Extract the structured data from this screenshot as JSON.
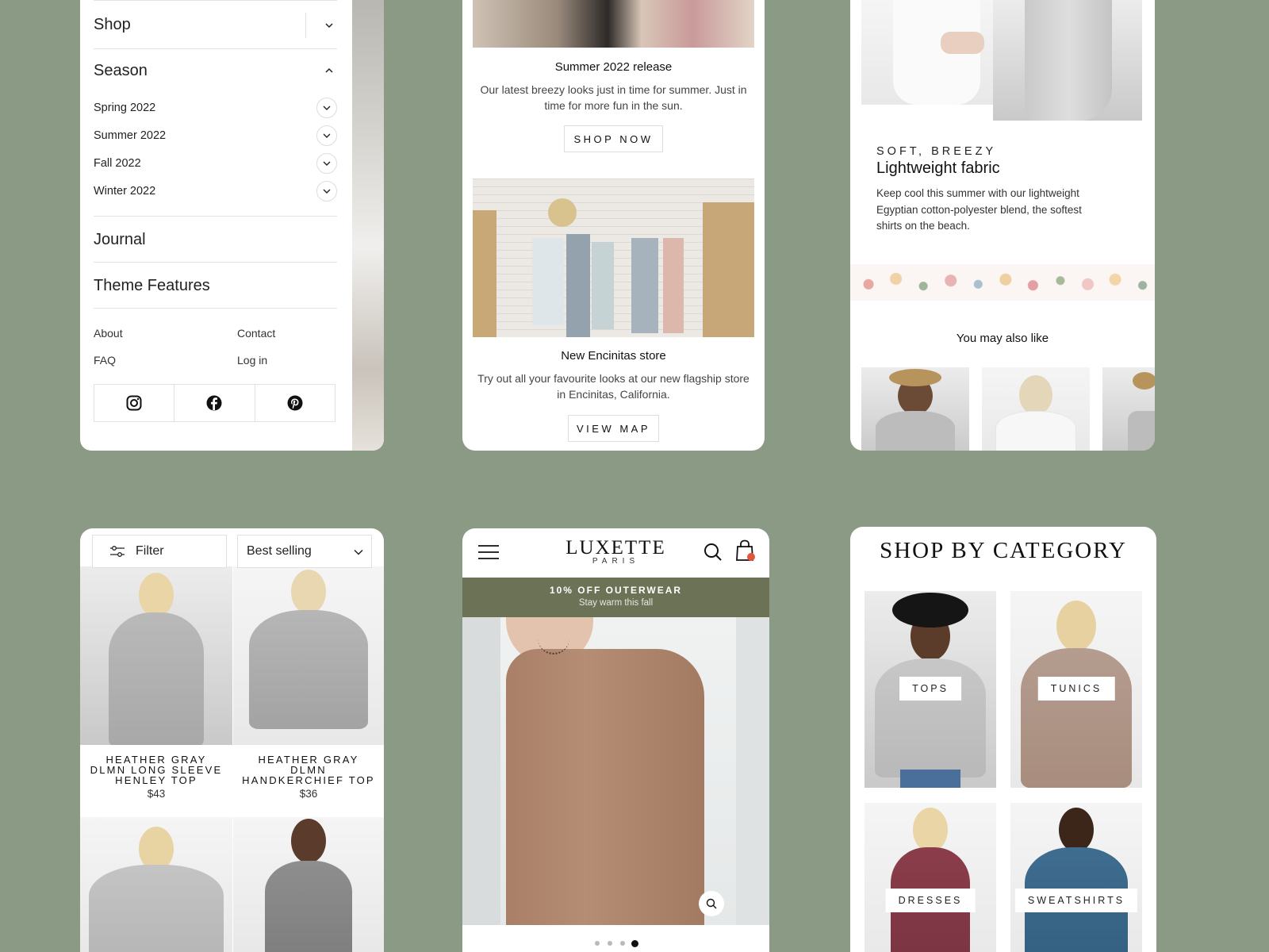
{
  "menu": {
    "shop_label": "Shop",
    "season_label": "Season",
    "season_items": [
      {
        "label": "Spring 2022"
      },
      {
        "label": "Summer 2022"
      },
      {
        "label": "Fall 2022"
      },
      {
        "label": "Winter 2022"
      }
    ],
    "journal_label": "Journal",
    "theme_features_label": "Theme Features",
    "footer_links": {
      "about": "About",
      "contact": "Contact",
      "faq": "FAQ",
      "login": "Log in"
    },
    "social_icons": [
      "instagram-icon",
      "facebook-icon",
      "pinterest-icon"
    ]
  },
  "promos": [
    {
      "title": "Summer 2022 release",
      "body": "Our latest breezy looks just in time for summer. Just in time for more fun in the sun.",
      "button": "SHOP NOW"
    },
    {
      "title": "New Encinitas store",
      "body": "Try out all your favourite looks at our new flagship store in Encinitas, California.",
      "button": "VIEW MAP"
    }
  ],
  "detail": {
    "eyebrow": "SOFT, BREEZY",
    "title": "Lightweight fabric",
    "body": "Keep cool this summer with our lightweight Egyptian cotton-polyester blend, the softest shirts on the beach.",
    "also_like": "You may also like"
  },
  "collection": {
    "filter_label": "Filter",
    "sort_value": "Best selling",
    "products": [
      {
        "name": "HEATHER GRAY DLMN LONG SLEEVE HENLEY TOP",
        "lines": [
          "HEATHER GRAY",
          "DLMN LONG SLEEVE",
          "HENLEY TOP"
        ],
        "price": "$43"
      },
      {
        "name": "HEATHER GRAY DLMN HANDKERCHIEF TOP",
        "lines": [
          "HEATHER GRAY",
          "DLMN",
          "HANDKERCHIEF TOP"
        ],
        "price": "$36"
      }
    ]
  },
  "home": {
    "brand": "LUXETTE",
    "brand_sub": "PARIS",
    "banner_title": "10% OFF OUTERWEAR",
    "banner_sub": "Stay warm this fall",
    "slide_count": 4,
    "active_slide": 4
  },
  "categories": {
    "heading": "SHOP BY CATEGORY",
    "items": [
      {
        "label": "TOPS"
      },
      {
        "label": "TUNICS"
      },
      {
        "label": "DRESSES"
      },
      {
        "label": "SWEATSHIRTS"
      }
    ]
  },
  "colors": {
    "background": "#8a9a84",
    "banner": "#6c7256",
    "cart_badge": "#e5533d",
    "card": "#ffffff"
  }
}
